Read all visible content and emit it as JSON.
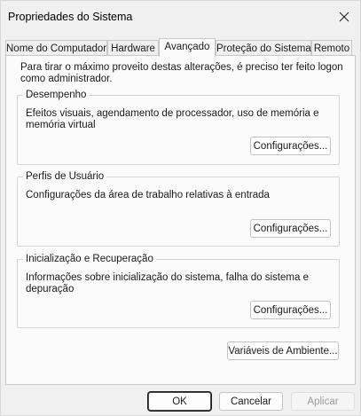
{
  "window": {
    "title": "Propriedades do Sistema"
  },
  "tabs": [
    {
      "label": "Nome do Computador"
    },
    {
      "label": "Hardware"
    },
    {
      "label": "Avançado"
    },
    {
      "label": "Proteção do Sistema"
    },
    {
      "label": "Remoto"
    }
  ],
  "active_tab": "Avançado",
  "intro_text": "Para tirar o máximo proveito destas alterações, é preciso ter feito logon como administrador.",
  "groups": {
    "performance": {
      "title": "Desempenho",
      "description": "Efeitos visuais, agendamento de processador, uso de memória e memória virtual",
      "button_label": "Configurações..."
    },
    "user_profiles": {
      "title": "Perfis de Usuário",
      "description": "Configurações da área de trabalho relativas à entrada",
      "button_label": "Configurações..."
    },
    "startup_recovery": {
      "title": "Inicialização e Recuperação",
      "description": "Informações sobre inicialização do sistema, falha do sistema e depuração",
      "button_label": "Configurações..."
    }
  },
  "environment_button_label": "Variáveis de Ambiente...",
  "footer": {
    "ok_label": "OK",
    "cancel_label": "Cancelar",
    "apply_label": "Aplicar"
  },
  "icons": {
    "close": "close-icon"
  }
}
